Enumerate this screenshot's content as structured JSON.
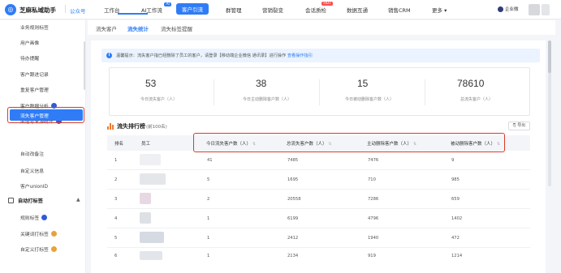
{
  "app": {
    "name": "芝麻私域助手",
    "publish_link": "公众号",
    "enterprise": "企业微"
  },
  "nav": [
    {
      "label": "工作台"
    },
    {
      "label": "AI工作流",
      "badge": "AI"
    },
    {
      "label": "客户引流",
      "active": true
    },
    {
      "label": "群管理"
    },
    {
      "label": "营销裂变"
    },
    {
      "label": "会话质检",
      "badge": "HOT"
    },
    {
      "label": "数据互通"
    },
    {
      "label": "销售CRM"
    },
    {
      "label": "更多 ▾"
    }
  ],
  "sidebar": {
    "items": [
      {
        "label": "业务规则标签"
      },
      {
        "label": "用户画像"
      },
      {
        "label": "待办提醒"
      },
      {
        "label": "客户跟进记录"
      },
      {
        "label": "重复客户管理"
      },
      {
        "label": "客户数据分析",
        "gem": "blue"
      },
      {
        "label": "渠道号来源统计",
        "gem": "blue"
      },
      {
        "label": "流失客户管理",
        "active": true
      },
      {
        "label": "自动改备注"
      },
      {
        "label": "自定义信息"
      },
      {
        "label": "客户unionID"
      }
    ],
    "group": {
      "label": "自动打标签",
      "chevron": "▲"
    },
    "group_items": [
      {
        "label": "规则标签",
        "gem": "blue"
      },
      {
        "label": "关键词打标签",
        "gem": "gold"
      },
      {
        "label": "自定义打标签",
        "gem": "gold"
      }
    ]
  },
  "subtabs": [
    {
      "label": "流失客户"
    },
    {
      "label": "流失统计",
      "active": true
    },
    {
      "label": "流失标签提醒"
    }
  ],
  "tip": {
    "text": "温馨提示：流失客户指已经删除了员工的客户，请登录【移动端企业微信 通讯录】进行操作 ",
    "link": "查看操作指引"
  },
  "stats": [
    {
      "value": "53",
      "label": "今日流失客户（人）"
    },
    {
      "value": "38",
      "label": "今日主动删除客户数（人）"
    },
    {
      "value": "15",
      "label": "今日被动删除客户数（人）"
    },
    {
      "value": "78610",
      "label": "总流失客户（人）"
    }
  ],
  "ranking": {
    "title": "流失排行榜",
    "subtitle": "(前100名)",
    "export_label": "导出"
  },
  "table": {
    "columns": [
      "排名",
      "员工",
      "今日流失客户数（人）",
      "总流失客户数（人）",
      "主动删除客户数（人）",
      "被动删除客户数（人）"
    ],
    "rows": [
      {
        "rank": "1",
        "today": "41",
        "total": "7485",
        "active": "7476",
        "passive": "9"
      },
      {
        "rank": "2",
        "today": "5",
        "total": "1695",
        "active": "710",
        "passive": "985"
      },
      {
        "rank": "3",
        "today": "2",
        "total": "20558",
        "active": "7286",
        "passive": "659"
      },
      {
        "rank": "4",
        "today": "1",
        "total": "6199",
        "active": "4796",
        "passive": "1402"
      },
      {
        "rank": "5",
        "today": "1",
        "total": "2412",
        "active": "1940",
        "passive": "472"
      },
      {
        "rank": "6",
        "today": "1",
        "total": "2134",
        "active": "919",
        "passive": "1214"
      }
    ]
  },
  "colors": {
    "accent": "#2f7cf6",
    "highlight_frame": "#d93a2c",
    "rank_icon": "#ef7a2e"
  }
}
